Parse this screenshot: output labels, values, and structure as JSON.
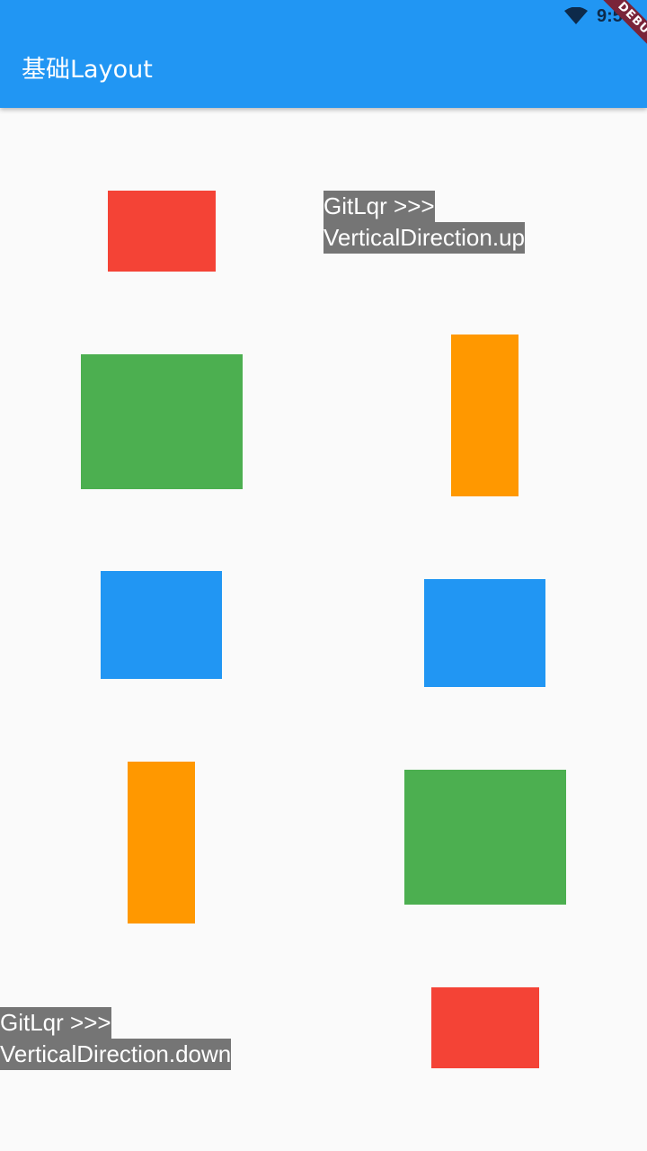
{
  "status_bar": {
    "time": "9:55",
    "icons": [
      "wifi-icon"
    ]
  },
  "debug_banner": {
    "label": "DEBUG"
  },
  "appbar": {
    "title": "基础Layout"
  },
  "columns": {
    "up": {
      "label_line1": "GitLqr >>>",
      "label_line2": "VerticalDirection.up",
      "boxes": [
        {
          "name": "orange-box",
          "color": "#ff9800"
        },
        {
          "name": "blue-box",
          "color": "#2196f3"
        },
        {
          "name": "green-box",
          "color": "#4caf50"
        },
        {
          "name": "red-box",
          "color": "#f44336"
        }
      ]
    },
    "down": {
      "label_line1": "GitLqr >>>",
      "label_line2": "VerticalDirection.down",
      "boxes": [
        {
          "name": "red-box",
          "color": "#f44336"
        },
        {
          "name": "green-box",
          "color": "#4caf50"
        },
        {
          "name": "blue-box",
          "color": "#2196f3"
        },
        {
          "name": "orange-box",
          "color": "#ff9800"
        }
      ]
    }
  }
}
